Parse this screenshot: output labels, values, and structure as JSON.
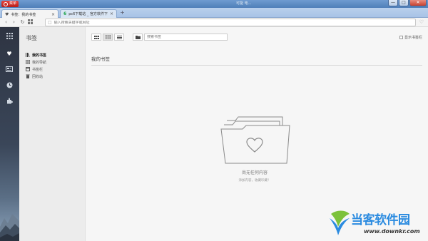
{
  "window": {
    "menu_label": "菜单",
    "title_right_text": "可能 电...",
    "controls": {
      "minimize": "—",
      "maximize": "□",
      "close": "✕"
    }
  },
  "tabs": [
    {
      "label": "书签：我的书签",
      "icon": "heart-icon",
      "active": true
    },
    {
      "label": "pc6下载站 _ 官方软件下载",
      "icon": "pc6-logo-icon",
      "active": false
    }
  ],
  "new_tab_label": "+",
  "address_bar": {
    "placeholder": "输入搜索关键字或网址"
  },
  "sidebar_icons": [
    "speed-dial-icon",
    "heart-icon",
    "news-icon",
    "history-icon",
    "extensions-icon"
  ],
  "panel": {
    "title": "书签",
    "items": [
      {
        "label": "我的书签",
        "icon": "bookmarks-icon",
        "active": true
      },
      {
        "label": "我的导航",
        "icon": "grid-icon",
        "active": false
      },
      {
        "label": "书签栏",
        "icon": "bookmark-bar-icon",
        "active": false
      },
      {
        "label": "回收站",
        "icon": "trash-icon",
        "active": false
      }
    ]
  },
  "main": {
    "view_buttons": [
      "large-grid-view-icon",
      "small-grid-view-icon",
      "list-view-icon"
    ],
    "add_folder_icon": "add-folder-icon",
    "search_placeholder": "搜索书签",
    "show_bookmark_bar_label": "显示书签栏",
    "section_title": "我的书签",
    "empty_title": "尚无任何内容",
    "empty_subtitle": "添加内容，收藏珍藏！"
  },
  "watermark": {
    "title": "当客软件园",
    "url": "www.downkr.com"
  },
  "colors": {
    "accent_red": "#cc2a22",
    "title_blue": "#5a88c2",
    "watermark_blue": "#2b8be0"
  }
}
